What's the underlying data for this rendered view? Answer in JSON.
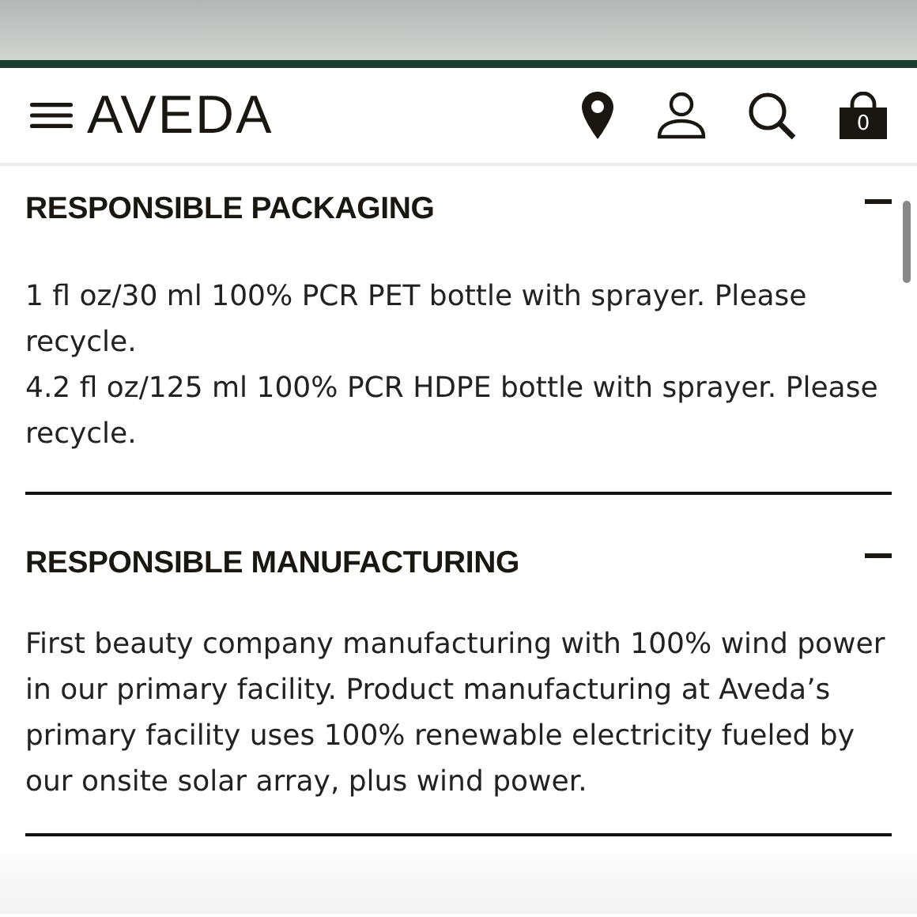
{
  "header": {
    "logo": "AVEDA",
    "cart_count": "0"
  },
  "sections": [
    {
      "title": "RESPONSIBLE PACKAGING",
      "expanded": true,
      "paragraphs": [
        "1 fl oz/30 ml 100% PCR PET bottle with sprayer. Please recycle.",
        "4.2 fl oz/125 ml 100% PCR HDPE bottle with sprayer. Please recycle."
      ]
    },
    {
      "title": "RESPONSIBLE MANUFACTURING",
      "expanded": true,
      "paragraphs": [
        "First beauty company manufacturing with 100% wind power in our primary facility. Product manufacturing at Aveda’s primary facility uses 100% renewable electricity fueled by our onsite solar array, plus wind power."
      ]
    }
  ]
}
